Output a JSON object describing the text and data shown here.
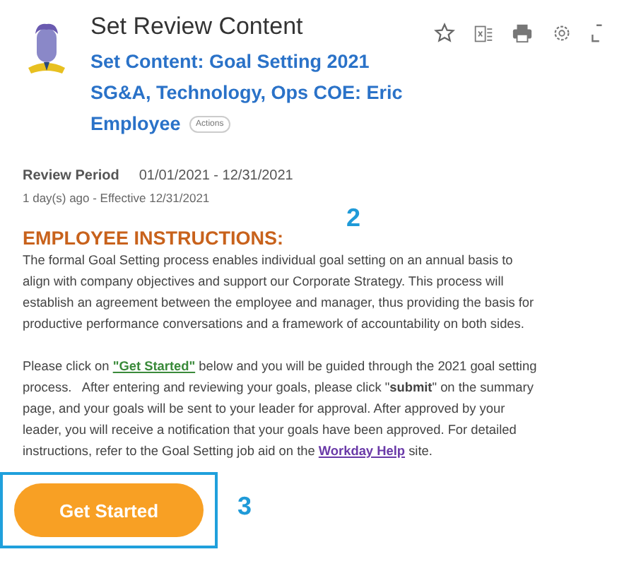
{
  "header": {
    "title": "Set Review Content",
    "subtitle": "Set Content: Goal Setting 2021 SG&A, Technology, Ops COE: Eric Employee",
    "actions_badge": "Actions"
  },
  "review": {
    "label": "Review Period",
    "value": "01/01/2021 - 12/31/2021",
    "meta": "1 day(s) ago - Effective 12/31/2021"
  },
  "instructions": {
    "heading": "EMPLOYEE INSTRUCTIONS:",
    "paragraph_1": [
      "The formal Goal Setting process enables individual goal setting on an annual basis to",
      "align with company objectives and support our Corporate Strategy. This process will",
      "establish an agreement between the employee and manager, thus providing the basis for",
      "productive performance conversations and a framework of accountability on both sides."
    ],
    "paragraph_2": [
      [
        {
          "kind": "text",
          "text": "Please click on "
        },
        {
          "kind": "link",
          "text": "\"Get Started\"",
          "color": "#3a8a3a"
        },
        {
          "kind": "text",
          "text": " below and you will be guided through the 2021 goal setting"
        }
      ],
      [
        {
          "kind": "text",
          "text": "process.   After entering and reviewing your goals, please click \"**submit**\" on the summary"
        }
      ],
      [
        {
          "kind": "text",
          "text": "page, and your goals will be sent to your leader for approval. After approved by your"
        }
      ],
      [
        {
          "kind": "text",
          "text": "leader, you will receive a notification that your goals have been approved. For detailed"
        }
      ],
      [
        {
          "kind": "text",
          "text": "instructions, refer to the Goal Setting job aid on the "
        },
        {
          "kind": "link",
          "text": "Workday Help",
          "color": "#6a3aa8"
        },
        {
          "kind": "text",
          "text": " site."
        }
      ]
    ]
  },
  "button": {
    "label": "Get Started",
    "highlighted": true
  },
  "annotations": [
    "2",
    "3"
  ]
}
